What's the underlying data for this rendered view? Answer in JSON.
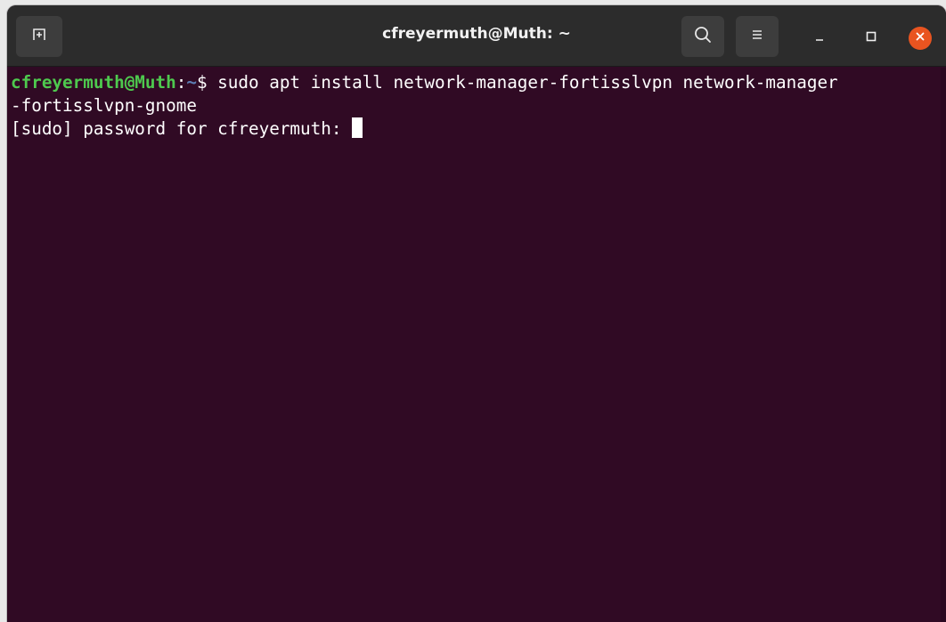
{
  "window": {
    "title": "cfreyermuth@Muth: ~",
    "icons": {
      "new_tab": "new-tab-icon",
      "search": "search-icon",
      "menu": "hamburger-menu-icon",
      "minimize": "minimize-icon",
      "maximize": "maximize-icon",
      "close": "close-icon"
    }
  },
  "terminal": {
    "prompt_user": "cfreyermuth@Muth",
    "prompt_colon": ":",
    "prompt_path": "~",
    "prompt_symbol": "$ ",
    "command_line1": "sudo apt install network-manager-fortisslvpn network-manager",
    "command_line2": "-fortisslvpn-gnome",
    "password_prompt": "[sudo] password for cfreyermuth: "
  },
  "colors": {
    "terminal_background": "#300a24",
    "prompt_user": "#4ec94e",
    "prompt_path": "#5d7fb5",
    "close_button": "#e95420",
    "titlebar": "#2c2c2c"
  }
}
